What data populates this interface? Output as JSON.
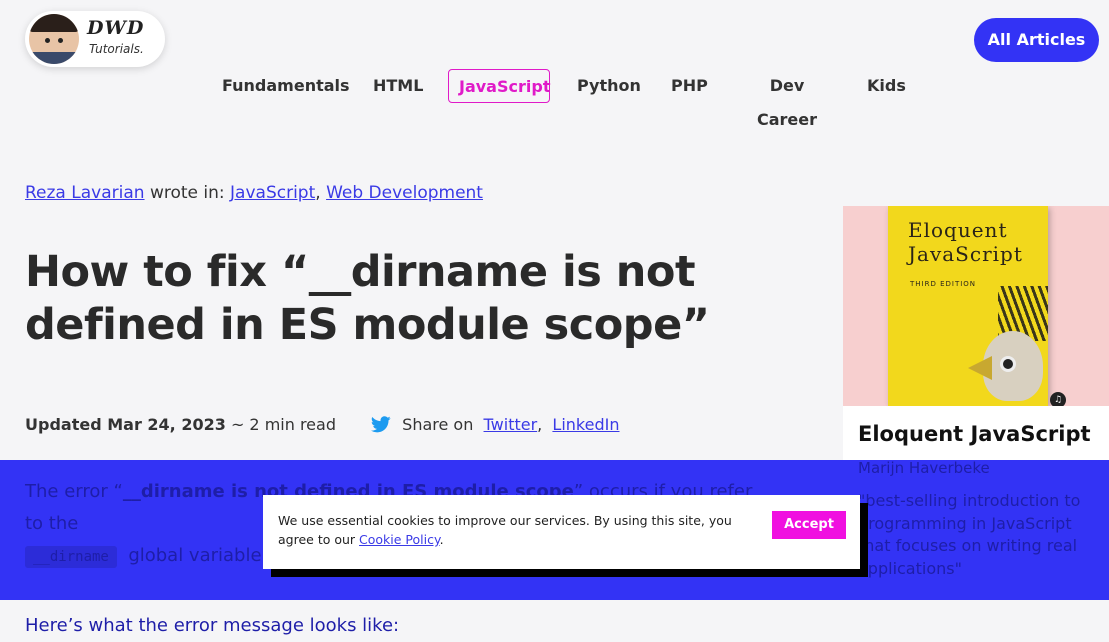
{
  "logo": {
    "mark": "DWD",
    "subtitle": "Tutorials."
  },
  "header": {
    "all_articles_label": "All Articles"
  },
  "nav": {
    "items": [
      {
        "label": "Fundamentals"
      },
      {
        "label": "HTML"
      },
      {
        "label": "JavaScript",
        "active": true
      },
      {
        "label": "Python"
      },
      {
        "label": "PHP"
      },
      {
        "label": "Dev Career"
      },
      {
        "label": "Kids"
      }
    ]
  },
  "byline": {
    "author": "Reza Lavarian",
    "wrote_in": "wrote in:",
    "category1": "JavaScript",
    "separator": ",",
    "category2": "Web Development"
  },
  "article": {
    "title": "How to fix “__dirname is not defined in ES module scope”",
    "updated": "Updated Mar 24, 2023",
    "read_time": "~ 2 min read",
    "share_label": "Share on",
    "share_twitter": "Twitter",
    "share_sep": ",",
    "share_linkedin": "LinkedIn",
    "body_p1_start": "The error “",
    "body_p1_bold": "__dirname is not defined in ES module scope",
    "body_p1_end": "” occurs if you refer to the",
    "body_code": "__dirname",
    "body_p1_cont": "global variable",
    "body_p2": "Here’s what the error message looks like:"
  },
  "book": {
    "cover_title": "Eloquent JavaScript",
    "cover_edition": "THIRD EDITION",
    "name": "Eloquent JavaScript",
    "author": "Marijn Haverbeke",
    "description": "\"best-selling introduction to programming in JavaScript that focuses on writing real applications\""
  },
  "cookie": {
    "text_before": "We use essential cookies to improve our services. By using this site, you agree to our",
    "link": "Cookie Policy",
    "text_after": ".",
    "accept_label": "Accept"
  },
  "colors": {
    "accent_blue": "#3333f5",
    "accent_magenta": "#e01ac8",
    "accept_button": "#f010e0"
  }
}
